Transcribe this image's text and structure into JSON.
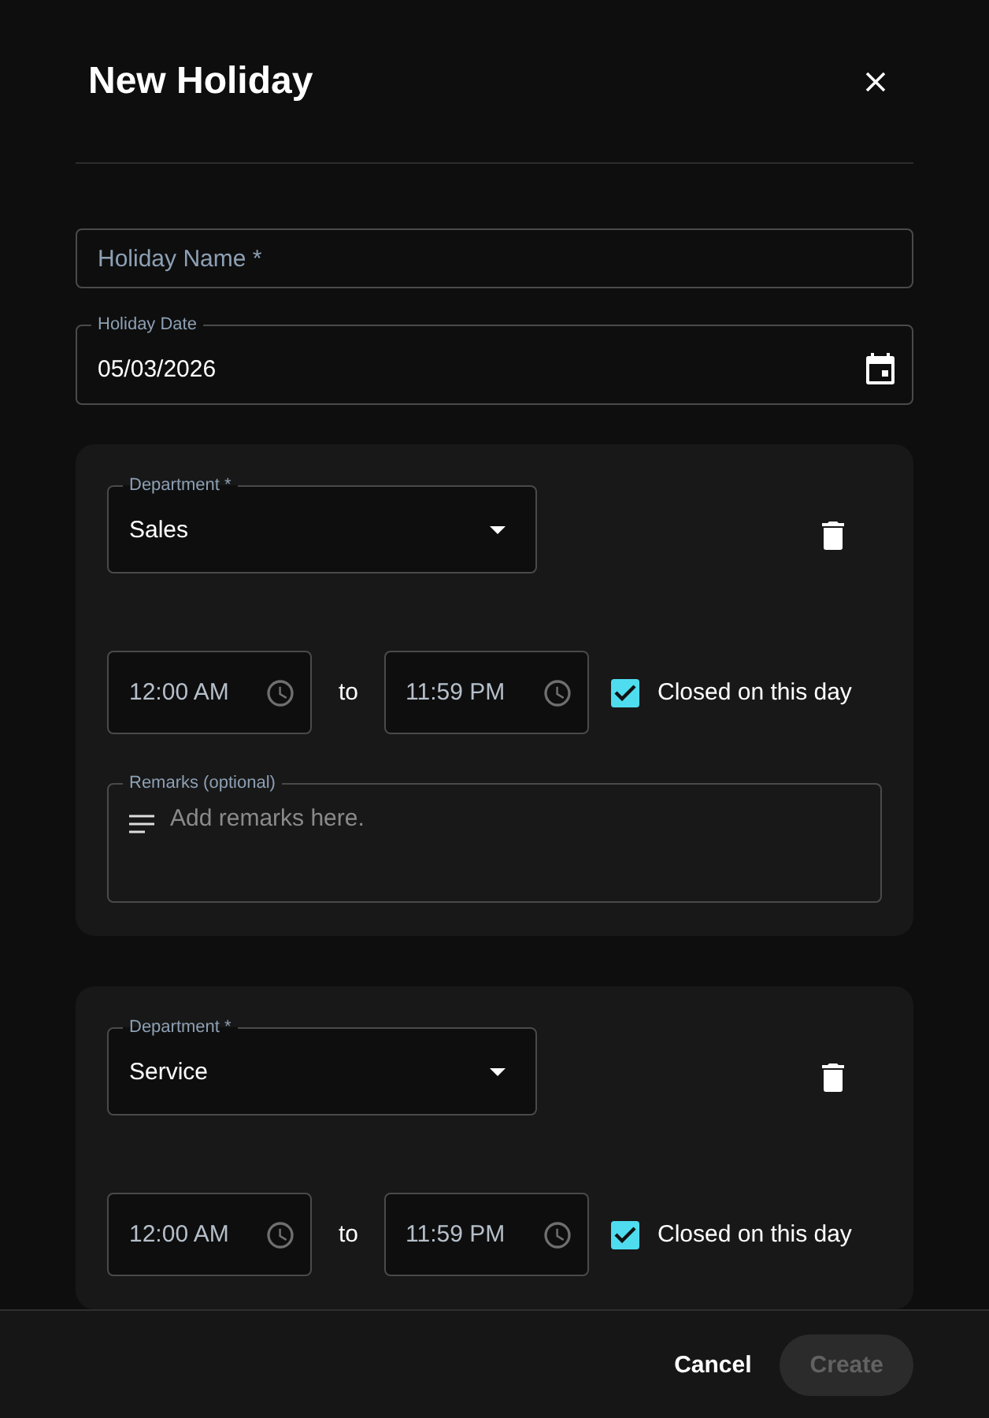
{
  "dialog": {
    "title": "New Holiday"
  },
  "holiday_name": {
    "placeholder": "Holiday Name *"
  },
  "holiday_date": {
    "label": "Holiday Date",
    "value": "05/03/2026"
  },
  "departments": [
    {
      "department_label": "Department *",
      "department": "Sales",
      "start_time": "12:00 AM",
      "separator": "to",
      "end_time": "11:59 PM",
      "closed": {
        "label": "Closed on this day",
        "checked": true
      },
      "remarks": {
        "label": "Remarks (optional)",
        "placeholder": "Add remarks here."
      }
    },
    {
      "department_label": "Department *",
      "department": "Service",
      "start_time": "12:00 AM",
      "separator": "to",
      "end_time": "11:59 PM",
      "closed": {
        "label": "Closed on this day",
        "checked": true
      }
    }
  ],
  "footer": {
    "buttons": [
      {
        "label": "Cancel",
        "kind": "text",
        "disabled": false
      },
      {
        "label": "Create",
        "kind": "filled",
        "disabled": true
      }
    ]
  }
}
